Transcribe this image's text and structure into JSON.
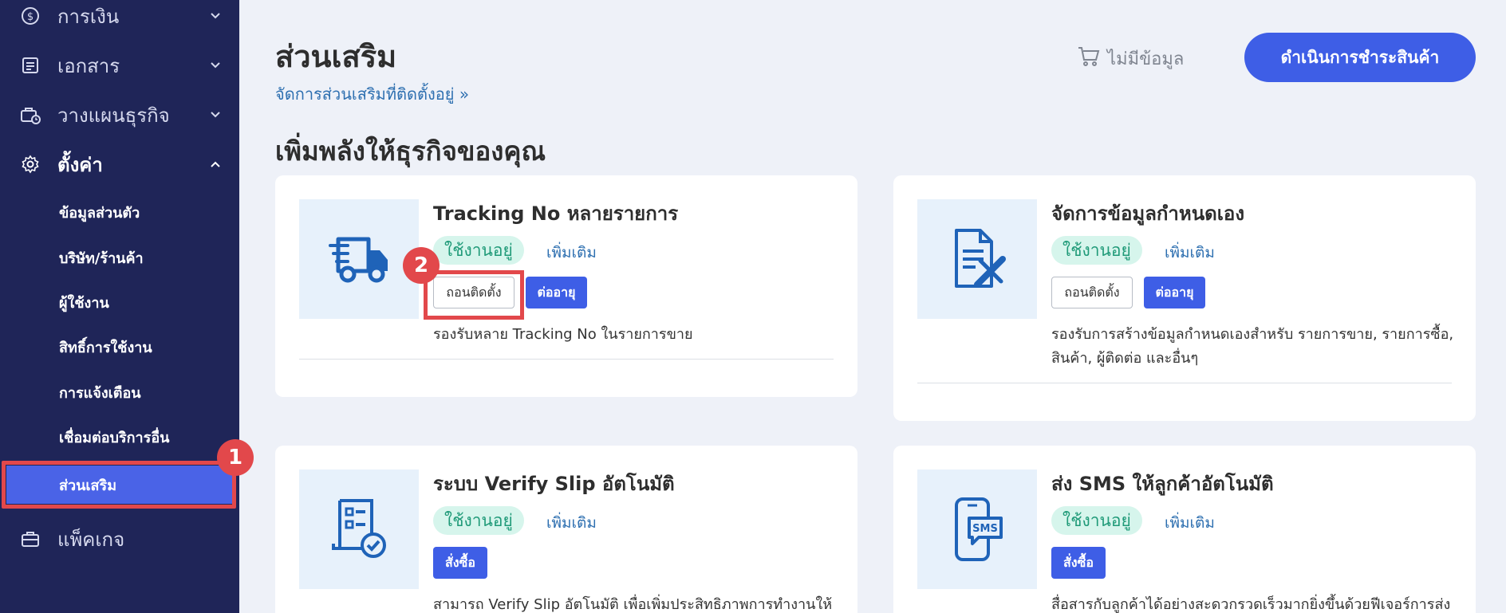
{
  "sidebar": {
    "menu": [
      {
        "label": "การเงิน",
        "icon": "dollar-icon"
      },
      {
        "label": "เอกสาร",
        "icon": "document-icon"
      },
      {
        "label": "วางแผนธุรกิจ",
        "icon": "briefcase-clock-icon"
      },
      {
        "label": "ตั้งค่า",
        "icon": "gear-icon"
      }
    ],
    "submenu": [
      {
        "label": "ข้อมูลส่วนตัว"
      },
      {
        "label": "บริษัท/ร้านค้า"
      },
      {
        "label": "ผู้ใช้งาน"
      },
      {
        "label": "สิทธิ์การใช้งาน"
      },
      {
        "label": "การแจ้งเตือน"
      },
      {
        "label": "เชื่อมต่อบริการอื่น"
      },
      {
        "label": "ส่วนเสริม"
      }
    ],
    "package": {
      "label": "แพ็คเกจ",
      "icon": "briefcase-icon"
    }
  },
  "markers": {
    "one": "1",
    "two": "2"
  },
  "header": {
    "title": "ส่วนเสริม",
    "manage_link": "จัดการส่วนเสริมที่ติดตั้งอยู่ »",
    "cart_label": "ไม่มีข้อมูล",
    "checkout_label": "ดำเนินการชำระสินค้า"
  },
  "section_title": "เพิ่มพลังให้ธุรกิจของคุณ",
  "cards": [
    {
      "title": "Tracking No หลายรายการ",
      "status": "ใช้งานอยู่",
      "more": "เพิ่มเติม",
      "uninstall": "ถอนติดตั้ง",
      "renew": "ต่ออายุ",
      "desc": "รองรับหลาย Tracking No ในรายการขาย",
      "icon": "truck-icon"
    },
    {
      "title": "จัดการข้อมูลกำหนดเอง",
      "status": "ใช้งานอยู่",
      "more": "เพิ่มเติม",
      "uninstall": "ถอนติดตั้ง",
      "renew": "ต่ออายุ",
      "desc": "รองรับการสร้างข้อมูลกำหนดเองสำหรับ รายการขาย, รายการซื้อ, สินค้า, ผู้ติดต่อ และอื่นๆ",
      "icon": "document-edit-icon"
    },
    {
      "title": "ระบบ Verify Slip อัตโนมัติ",
      "status": "ใช้งานอยู่",
      "more": "เพิ่มเติม",
      "order": "สั่งซื้อ",
      "desc": "สามารถ Verify Slip อัตโนมัติ เพื่อเพิ่มประสิทธิภาพการทำงานให้",
      "icon": "receipt-check-icon"
    },
    {
      "title": "ส่ง SMS ให้ลูกค้าอัตโนมัติ",
      "status": "ใช้งานอยู่",
      "more": "เพิ่มเติม",
      "order": "สั่งซื้อ",
      "desc": "สื่อสารกับลูกค้าได้อย่างสะดวกรวดเร็วมากยิ่งขึ้นด้วยฟีเจอร์การส่ง",
      "icon": "phone-sms-icon"
    }
  ]
}
